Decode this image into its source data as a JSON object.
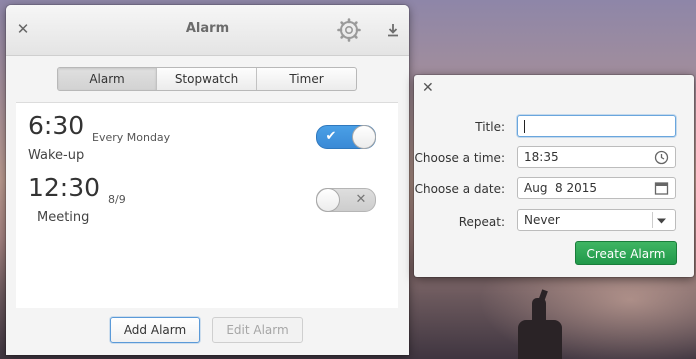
{
  "window": {
    "title": "Alarm",
    "close_glyph": "✕",
    "settings_icon": "gear-icon",
    "download_icon": "download-icon"
  },
  "modes": [
    "Alarm",
    "Stopwatch",
    "Timer"
  ],
  "active_mode": "Alarm",
  "alarms": [
    {
      "time": "6:30",
      "repeat": "Every Monday",
      "name": "Wake-up",
      "enabled": true
    },
    {
      "time": "12:30",
      "repeat": "8/9",
      "name": "Meeting",
      "enabled": false
    }
  ],
  "toggle_marks": {
    "on": "✔",
    "off": "✕"
  },
  "buttons": {
    "add": "Add Alarm",
    "edit": "Edit Alarm"
  },
  "dialog": {
    "close_glyph": "✕",
    "title_label": "Title:",
    "title_value": "",
    "time_label": "Choose a time:",
    "time_value": "18:35",
    "date_label": "Choose a date:",
    "date_value": "Aug  8 2015",
    "repeat_label": "Repeat:",
    "repeat_value": "Never",
    "create_button": "Create Alarm"
  },
  "colors": {
    "toggle_on": "#3a8ad6",
    "create_button": "#21994a",
    "focus_ring": "#6aa6dd"
  }
}
